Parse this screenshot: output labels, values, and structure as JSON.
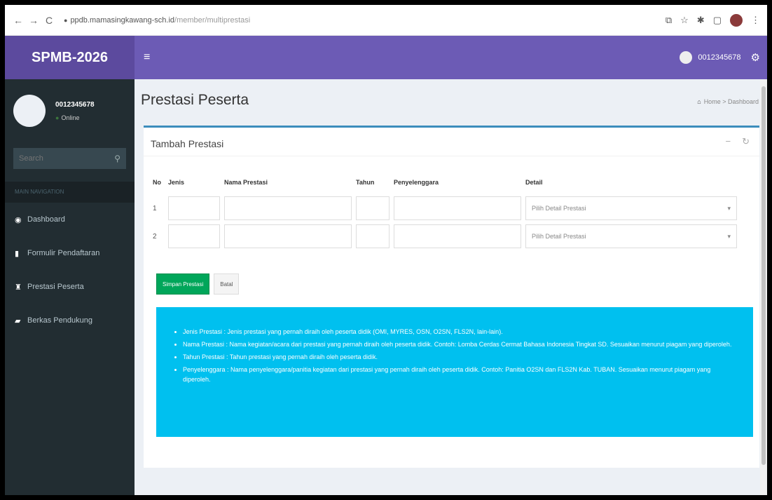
{
  "browser": {
    "url_host": "ppdb.mamasingkawang-sch.id",
    "url_path": "/member/multiprestasi"
  },
  "app": {
    "logo": "SPMB-2026",
    "user_id": "0012345678"
  },
  "sidebar": {
    "user_name": "0012345678",
    "status": "Online",
    "search_placeholder": "Search",
    "menu_header": "MAIN NAVIGATION",
    "items": [
      {
        "label": "Dashboard",
        "icon": "dashboard-icon"
      },
      {
        "label": "Formulir Pendaftaran",
        "icon": "file-icon"
      },
      {
        "label": "Prestasi Peserta",
        "icon": "trophy-icon"
      },
      {
        "label": "Berkas Pendukung",
        "icon": "folder-icon"
      }
    ]
  },
  "page": {
    "title": "Prestasi Peserta",
    "breadcrumb_home": "Home",
    "breadcrumb_current": "Dashboard"
  },
  "box": {
    "title": "Tambah Prestasi",
    "headers": [
      "No",
      "Jenis",
      "Nama Prestasi",
      "Tahun",
      "Penyelenggara",
      "Detail"
    ],
    "rows": [
      {
        "no": "1",
        "detail_placeholder": "Pilih Detail Prestasi"
      },
      {
        "no": "2",
        "detail_placeholder": "Pilih Detail Prestasi"
      }
    ],
    "save_label": "Simpan Prestasi",
    "cancel_label": "Batal"
  },
  "notes": [
    "Jenis Prestasi : Jenis prestasi yang pernah diraih oleh peserta didik (OMI, MYRES, OSN, O2SN, FLS2N, lain-lain).",
    "Nama Prestasi : Nama kegiatan/acara dari prestasi yang pernah diraih oleh peserta didik. Contoh: Lomba Cerdas Cermat Bahasa Indonesia Tingkat SD. Sesuaikan menurut piagam yang diperoleh.",
    "Tahun Prestasi : Tahun prestasi yang pernah diraih oleh peserta didik.",
    "Penyelenggara : Nama penyelenggara/panitia kegiatan dari prestasi yang pernah diraih oleh peserta didik. Contoh: Panitia O2SN dan FLS2N Kab. TUBAN. Sesuaikan menurut piagam yang diperoleh."
  ],
  "colors": {
    "logo_bg": "#5c4a9e",
    "header_bg": "#6c5bb5",
    "sidebar_bg": "#222d32",
    "callout_bg": "#00c0ef",
    "save_button": "#00a65a"
  }
}
